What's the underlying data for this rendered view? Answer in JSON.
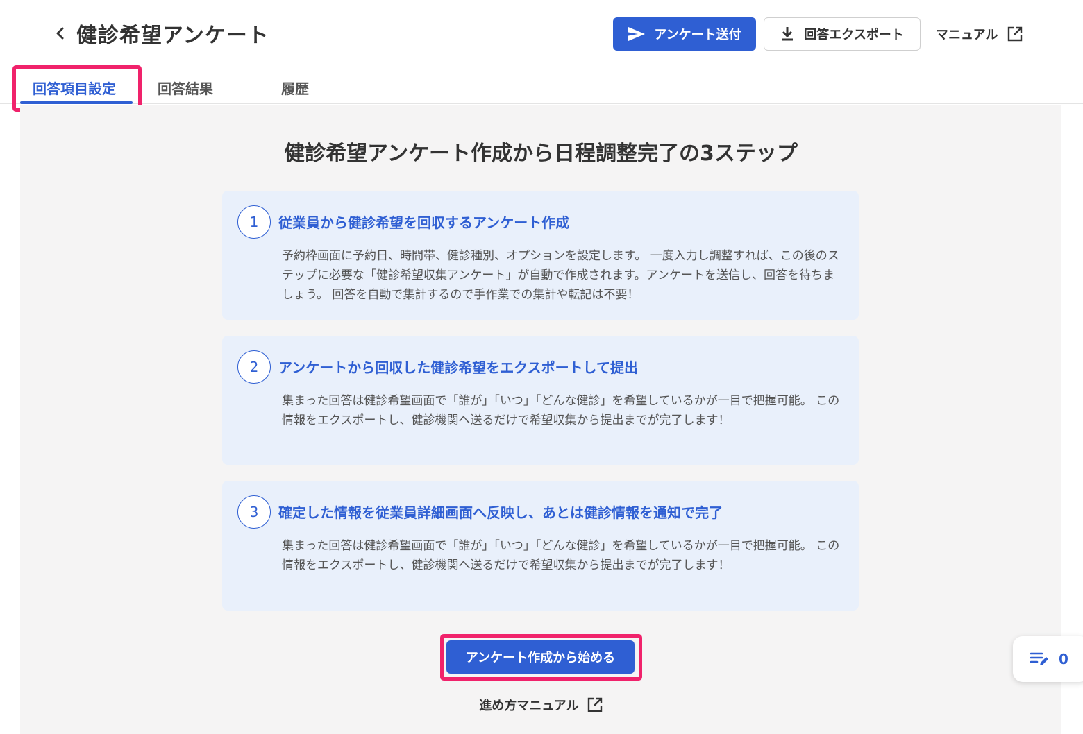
{
  "header": {
    "title": "健診希望アンケート",
    "send_button": "アンケート送付",
    "export_button": "回答エクスポート",
    "manual_link": "マニュアル"
  },
  "tabs": [
    {
      "label": "回答項目設定",
      "active": true
    },
    {
      "label": "回答結果",
      "active": false
    },
    {
      "label": "履歴",
      "active": false
    }
  ],
  "main": {
    "heading": "健診希望アンケート作成から日程調整完了の3ステップ",
    "steps": [
      {
        "number": "1",
        "title": "従業員から健診希望を回収するアンケート作成",
        "description": "予約枠画面に予約日、時間帯、健診種別、オプションを設定します。 一度入力し調整すれば、この後のステップに必要な「健診希望収集アンケート」が自動で作成されます。アンケートを送信し、回答を待ちましょう。 回答を自動で集計するので手作業での集計や転記は不要！"
      },
      {
        "number": "2",
        "title": "アンケートから回収した健診希望をエクスポートして提出",
        "description": "集まった回答は健診希望画面で「誰が」「いつ」「どんな健診」を希望しているかが一目で把握可能。 この情報をエクスポートし、健診機関へ送るだけで希望収集から提出までが完了します！"
      },
      {
        "number": "3",
        "title": "確定した情報を従業員詳細画面へ反映し、あとは健診情報を通知で完了",
        "description": "集まった回答は健診希望画面で「誰が」「いつ」「どんな健診」を希望しているかが一目で把握可能。 この情報をエクスポートし、健診機関へ送るだけで希望収集から提出までが完了します！"
      }
    ],
    "start_button": "アンケート作成から始める",
    "manual_link": "進め方マニュアル"
  },
  "memo": {
    "count": "0"
  },
  "colors": {
    "accent": "#2f5fd3",
    "highlight": "#f0226b",
    "card_bg": "#e9f0fb",
    "main_bg": "#f5f4f4"
  },
  "icons": {
    "back": "chevron-left-icon",
    "send": "paper-plane-icon",
    "export": "download-icon",
    "external": "external-link-icon",
    "memo": "edit-note-icon"
  }
}
